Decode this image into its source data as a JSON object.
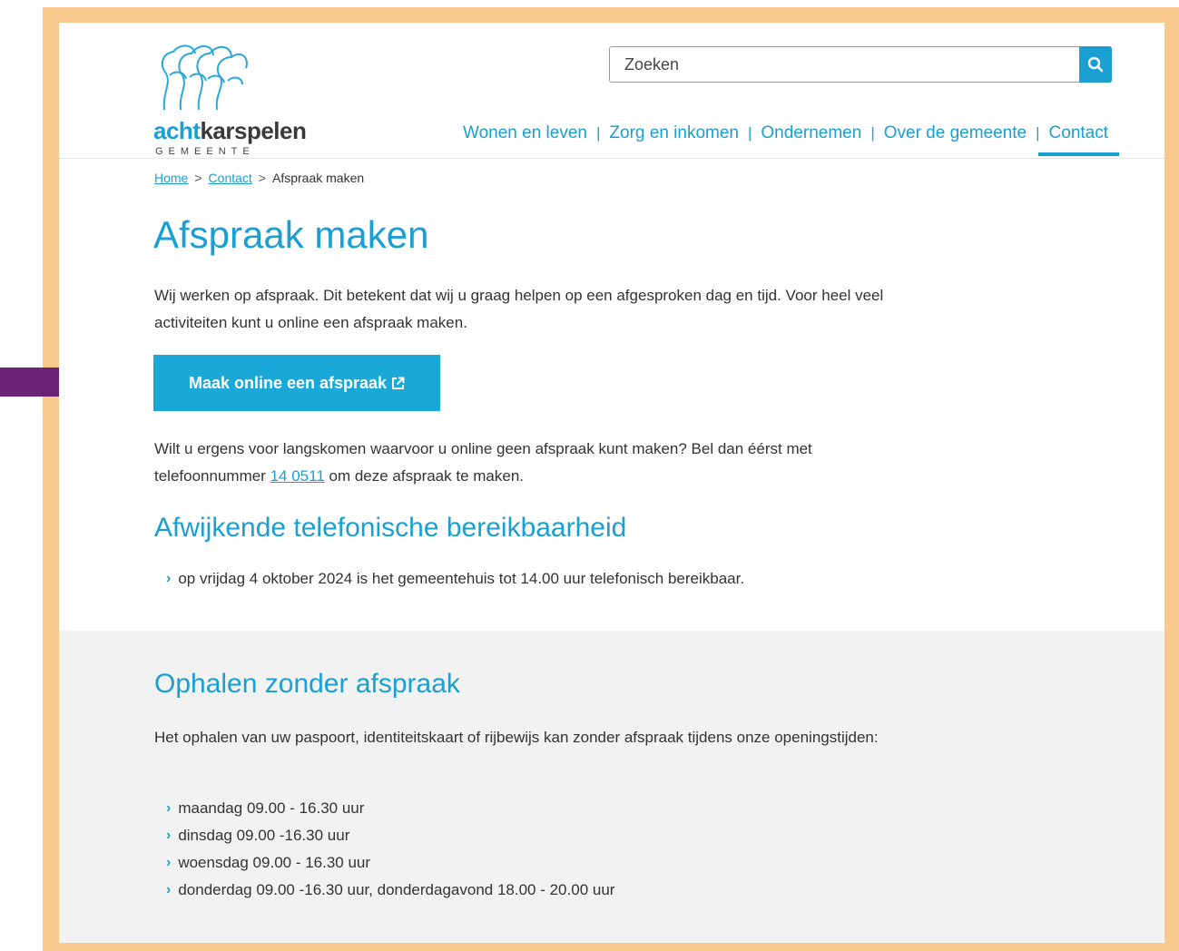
{
  "logo": {
    "word_part1": "acht",
    "word_part2": "karspelen",
    "subtitle": "GEMEENTE"
  },
  "search": {
    "placeholder": "Zoeken",
    "icon": "search-icon"
  },
  "nav": {
    "items": [
      {
        "label": "Wonen en leven"
      },
      {
        "label": "Zorg en inkomen"
      },
      {
        "label": "Ondernemen"
      },
      {
        "label": "Over de gemeente"
      },
      {
        "label": "Contact"
      }
    ],
    "active": "Contact",
    "separator": "|"
  },
  "breadcrumb": {
    "home": "Home",
    "contact": "Contact",
    "current": "Afspraak maken",
    "separator": ">"
  },
  "main": {
    "title": "Afspraak maken",
    "intro": "Wij werken op afspraak. Dit betekent dat wij u graag helpen op een afgesproken dag en tijd. Voor heel veel activiteiten kunt u online een afspraak maken.",
    "cta_label": "Maak online een afspraak",
    "cta_icon": "external-link-icon",
    "phone_text_before": "Wilt u ergens voor langskomen waarvoor u online geen afspraak kunt maken? Bel dan éérst met telefoonnummer ",
    "phone_number": "14 0511",
    "phone_text_after": " om deze afspraak te maken.",
    "section2_title": "Afwijkende telefonische bereikbaarheid",
    "section2_items": [
      "op vrijdag 4 oktober 2024 is het gemeentehuis tot 14.00 uur telefonisch bereikbaar."
    ]
  },
  "pickup": {
    "title": "Ophalen zonder afspraak",
    "intro": "Het ophalen van uw paspoort, identiteitskaart of rijbewijs kan zonder afspraak tijdens onze openingstijden:",
    "hours": [
      "maandag 09.00 - 16.30 uur",
      "dinsdag 09.00 -16.30 uur",
      "woensdag 09.00 - 16.30 uur",
      "donderdag 09.00 -16.30 uur, donderdagavond 18.00 - 20.00 uur"
    ]
  },
  "colors": {
    "accent": "#1a9fd3",
    "frame": "#f7c98d",
    "arrow": "#6b2277",
    "grey_band": "#f2f2f2"
  }
}
